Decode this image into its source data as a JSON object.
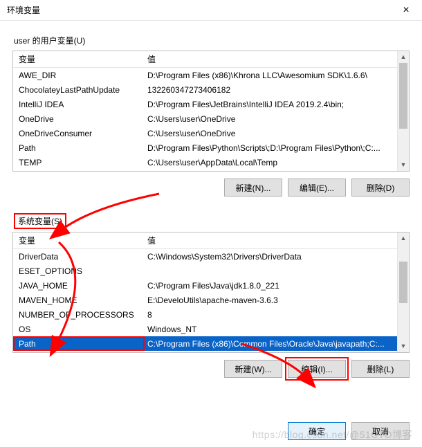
{
  "window": {
    "title": "环境变量",
    "close": "×"
  },
  "user_vars": {
    "label": "user 的用户变量(U)",
    "header_name": "变量",
    "header_value": "值",
    "rows": [
      {
        "name": "AWE_DIR",
        "value": "D:\\Program Files (x86)\\Khrona LLC\\Awesomium SDK\\1.6.6\\"
      },
      {
        "name": "ChocolateyLastPathUpdate",
        "value": "132260347273406182"
      },
      {
        "name": "IntelliJ IDEA",
        "value": "D:\\Program Files\\JetBrains\\IntelliJ IDEA 2019.2.4\\bin;"
      },
      {
        "name": "OneDrive",
        "value": "C:\\Users\\user\\OneDrive"
      },
      {
        "name": "OneDriveConsumer",
        "value": "C:\\Users\\user\\OneDrive"
      },
      {
        "name": "Path",
        "value": "D:\\Program Files\\Python\\Scripts\\;D:\\Program Files\\Python\\;C:..."
      },
      {
        "name": "TEMP",
        "value": "C:\\Users\\user\\AppData\\Local\\Temp"
      }
    ],
    "buttons": {
      "new": "新建(N)...",
      "edit": "编辑(E)...",
      "delete": "删除(D)"
    }
  },
  "system_vars": {
    "label": "系统变量(S)",
    "header_name": "变量",
    "header_value": "值",
    "rows": [
      {
        "name": "DriverData",
        "value": "C:\\Windows\\System32\\Drivers\\DriverData"
      },
      {
        "name": "ESET_OPTIONS",
        "value": ""
      },
      {
        "name": "JAVA_HOME",
        "value": "C:\\Program Files\\Java\\jdk1.8.0_221"
      },
      {
        "name": "MAVEN_HOME",
        "value": "E:\\DeveloUtils\\apache-maven-3.6.3"
      },
      {
        "name": "NUMBER_OF_PROCESSORS",
        "value": "8"
      },
      {
        "name": "OS",
        "value": "Windows_NT"
      },
      {
        "name": "Path",
        "value": "C:\\Program Files (x86)\\Common Files\\Oracle\\Java\\javapath;C:..."
      }
    ],
    "buttons": {
      "new": "新建(W)...",
      "edit": "编辑(I)...",
      "delete": "删除(L)"
    }
  },
  "footer": {
    "ok": "确定",
    "cancel": "取消"
  },
  "watermark": "https://blog.csdn.net/@51CTO博客"
}
